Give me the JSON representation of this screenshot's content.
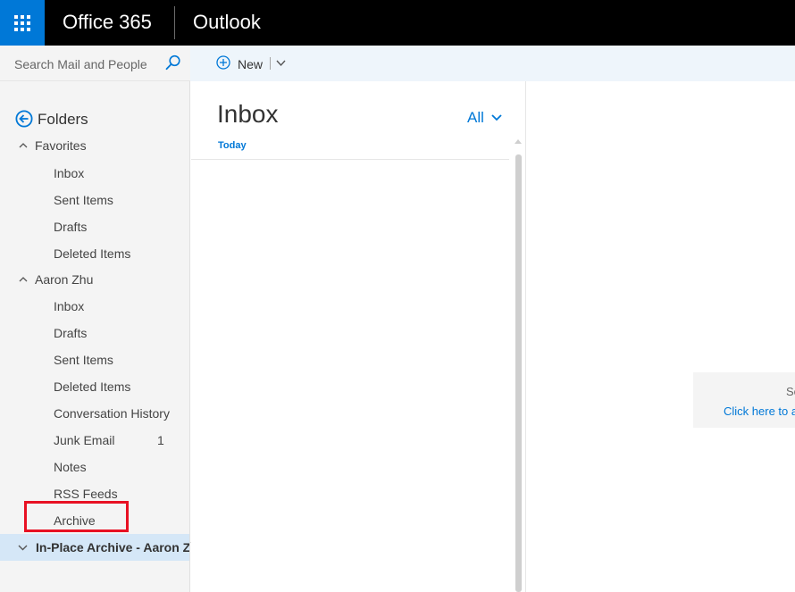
{
  "header": {
    "app_name": "Office 365",
    "app_title": "Outlook"
  },
  "search": {
    "placeholder": "Search Mail and People"
  },
  "toolbar": {
    "new_label": "New"
  },
  "folder_pane": {
    "title": "Folders",
    "groups": [
      {
        "label": "Favorites",
        "items": [
          {
            "label": "Inbox"
          },
          {
            "label": "Sent Items"
          },
          {
            "label": "Drafts"
          },
          {
            "label": "Deleted Items"
          }
        ]
      },
      {
        "label": "Aaron Zhu",
        "items": [
          {
            "label": "Inbox"
          },
          {
            "label": "Drafts"
          },
          {
            "label": "Sent Items"
          },
          {
            "label": "Deleted Items"
          },
          {
            "label": "Conversation History"
          },
          {
            "label": "Junk Email",
            "count": "1"
          },
          {
            "label": "Notes"
          },
          {
            "label": "RSS Feeds"
          },
          {
            "label": "Archive"
          }
        ]
      }
    ],
    "selected_group": "In-Place Archive - Aaron Zhu"
  },
  "message_list": {
    "title": "Inbox",
    "filter": "All",
    "section": "Today"
  },
  "reading_pane": {
    "line1": "Se",
    "link": "Click here to a"
  },
  "colors": {
    "accent": "#0078d7",
    "header_bg": "#000000",
    "highlight_border": "#e81123",
    "selected_bg": "#d5e7f7"
  }
}
